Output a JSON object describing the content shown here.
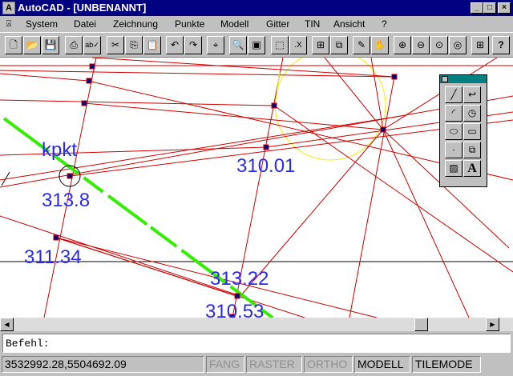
{
  "titlebar": {
    "title": "AutoCAD - [UNBENANNT]",
    "app_icon": "autocad-icon",
    "buttons": {
      "minimize": "_",
      "maximize": "□",
      "close": "×"
    }
  },
  "menubar": {
    "items": [
      {
        "label": "System"
      },
      {
        "label": "Datei"
      },
      {
        "label": "Zeichnung"
      },
      {
        "label": "Punkte"
      },
      {
        "label": "Modell"
      },
      {
        "label": "Gitter"
      },
      {
        "label": "TIN"
      },
      {
        "label": "Ansicht"
      },
      {
        "label": "?"
      }
    ]
  },
  "toolbar": {
    "icons": [
      "new-icon",
      "open-icon",
      "save-icon",
      "print-icon",
      "spellcheck-icon",
      "cut-icon",
      "copy-icon",
      "paste-icon",
      "undo-icon",
      "redo-icon",
      "snap-icon",
      "zoom-window-icon",
      "aerial-view-icon",
      "select-icon",
      "xref-icon",
      "block-icon",
      "layer-icon",
      "pencil-icon",
      "pan-icon",
      "zoom-in-icon",
      "zoom-out-icon",
      "zoom-all-icon",
      "zoom-extents-icon",
      "tile-icon",
      "help-icon"
    ]
  },
  "drawing": {
    "labels": {
      "kpkt": "kpkt",
      "l310_01": "310.01",
      "l313_8": "313.8",
      "l311_34": "311.34",
      "l313_22": "313.22",
      "l310_53": "310.53"
    },
    "colors": {
      "lines": "#d00000",
      "highlight": "#33ee00",
      "circle": "#f0f000",
      "label": "#2a2af0",
      "point": "#000080"
    }
  },
  "palette": {
    "icons": [
      "line-icon",
      "arc-continue-icon",
      "arc-icon",
      "circle-icon",
      "ellipse-icon",
      "rectangle-icon",
      "point-icon",
      "insert-block-icon",
      "hatch-icon",
      "text-icon"
    ]
  },
  "command": {
    "prompt": "Befehl:"
  },
  "statusbar": {
    "coords": "3532992.28,5504692.09",
    "fang": "FANG",
    "raster": "RASTER",
    "ortho": "ORTHO",
    "modell": "MODELL",
    "tilemode": "TILEMODE"
  }
}
